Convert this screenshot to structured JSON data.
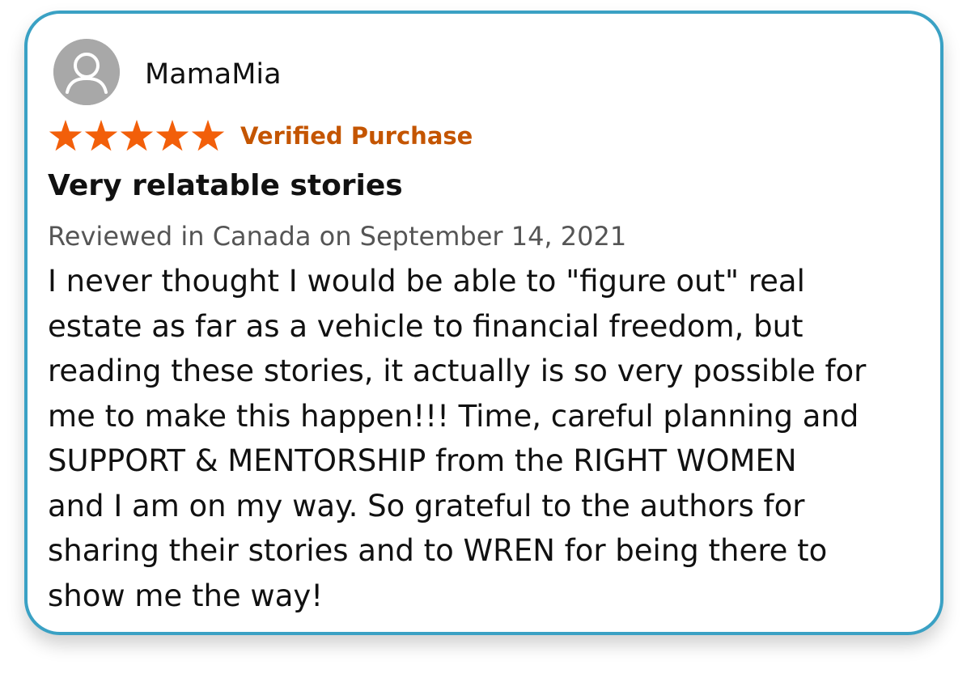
{
  "review": {
    "reviewer_name": "MamaMia",
    "avatar_icon": "default-user-avatar-icon",
    "rating": 5,
    "rating_max": 5,
    "star_color": "#f25f0a",
    "badge": "Verified Purchase",
    "badge_color": "#c45500",
    "title": "Very relatable stories",
    "meta": "Reviewed in Canada on September 14, 2021",
    "body_lines": [
      "I never thought I would be able to \"figure out\" real",
      "estate as far as a vehicle to financial freedom, but",
      "reading these stories, it actually is so very possible for",
      "me to make this happen!!! Time, careful planning and",
      "SUPPORT & MENTORSHIP from the RIGHT WOMEN",
      "and I am on my way. So grateful to the authors for",
      "sharing their stories and to WREN for being there to",
      "show me the way!"
    ]
  },
  "card_border_color": "#3aa1c4"
}
